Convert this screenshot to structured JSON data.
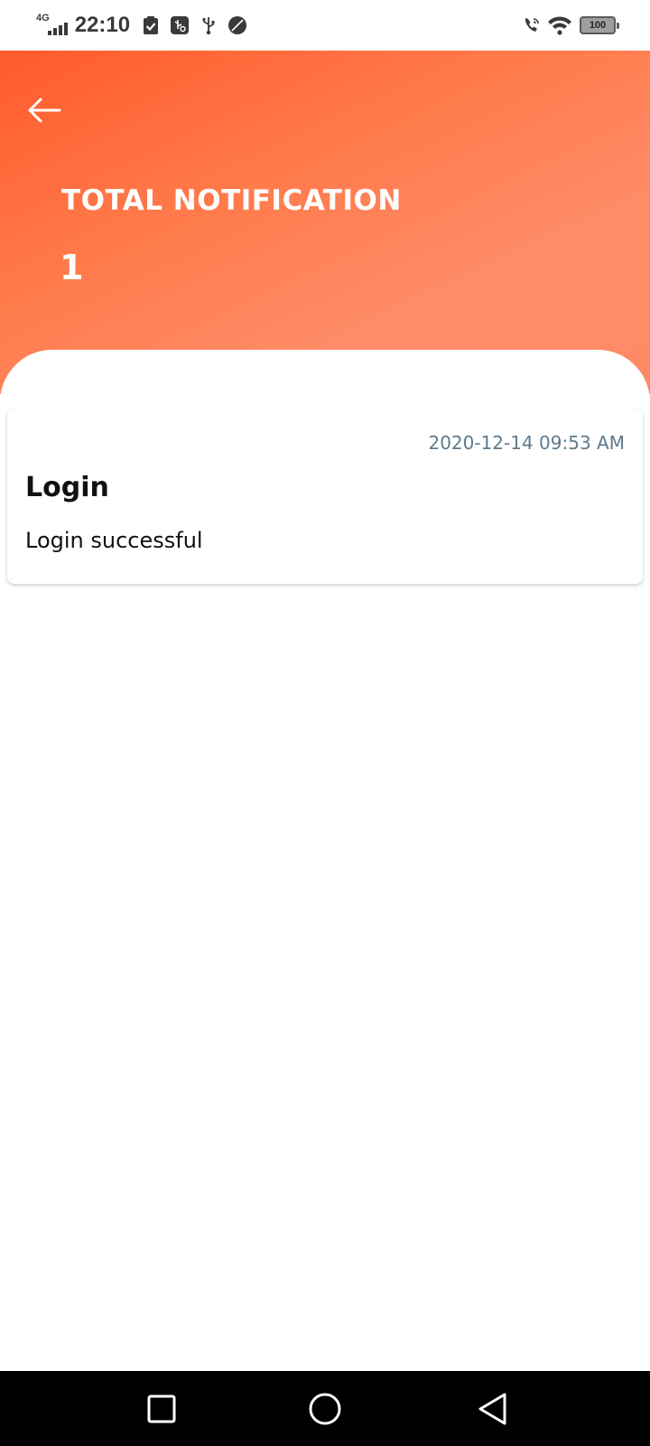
{
  "status_bar": {
    "network_type": "4G",
    "time": "22:10",
    "battery_level": "100",
    "icons": [
      "signal-icon",
      "clipboard-check-icon",
      "usb-debug-icon",
      "usb-icon",
      "leaf-icon",
      "wifi-calling-icon",
      "wifi-icon",
      "battery-icon"
    ]
  },
  "header": {
    "title": "TOTAL NOTIFICATION",
    "count": "1",
    "background_colors": [
      "#ff5a2c",
      "#ff8a66"
    ]
  },
  "notifications": [
    {
      "date": "2020-12-14 09:53 AM",
      "title": "Login",
      "message": "Login successful"
    }
  ],
  "navigation_bar": {
    "icons": [
      "recents-icon",
      "home-icon",
      "back-icon"
    ]
  }
}
